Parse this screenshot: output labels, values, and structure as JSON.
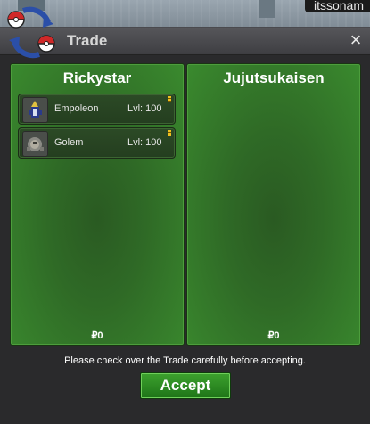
{
  "game": {
    "player_tag": "itssonam"
  },
  "trade_window": {
    "title": "Trade",
    "close_label": "×",
    "left": {
      "player": "Rickystar",
      "money": "₽0",
      "pokemon": [
        {
          "name": "Empoleon",
          "level": "Lvl: 100"
        },
        {
          "name": "Golem",
          "level": "Lvl: 100"
        }
      ]
    },
    "right": {
      "player": "Jujutsukaisen",
      "money": "₽0",
      "pokemon": []
    },
    "notice": "Please check over the Trade carefully before accepting.",
    "accept_label": "Accept"
  },
  "colors": {
    "panel_green": "#2f6a26",
    "accept_green": "#2a8c22",
    "titlebar": "#48484c"
  }
}
